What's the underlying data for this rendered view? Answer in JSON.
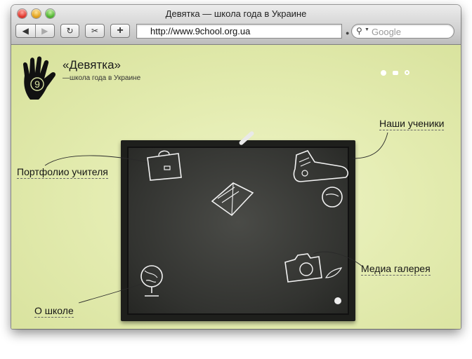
{
  "window": {
    "title": "Девятка — школа года в Украине"
  },
  "toolbar": {
    "back_icon": "◀",
    "forward_icon": "▶",
    "reload_icon": "↻",
    "snip_icon": "✂",
    "add_icon": "+"
  },
  "addressbar": {
    "url": "http://www.9chool.org.ua"
  },
  "search": {
    "placeholder": "Google"
  },
  "site": {
    "logo_digit": "9",
    "brand_name": "«Девятка»",
    "brand_tagline": "—школа года в Украине"
  },
  "nav": {
    "students": "Наши ученики",
    "portfolio": "Портфолио учителя",
    "media": "Медиа галерея",
    "about": "О школе"
  },
  "colors": {
    "page_bg": "#e4ecb1",
    "board_frame": "#1e1f1c",
    "chalk_lines": "#f2f2f2"
  }
}
